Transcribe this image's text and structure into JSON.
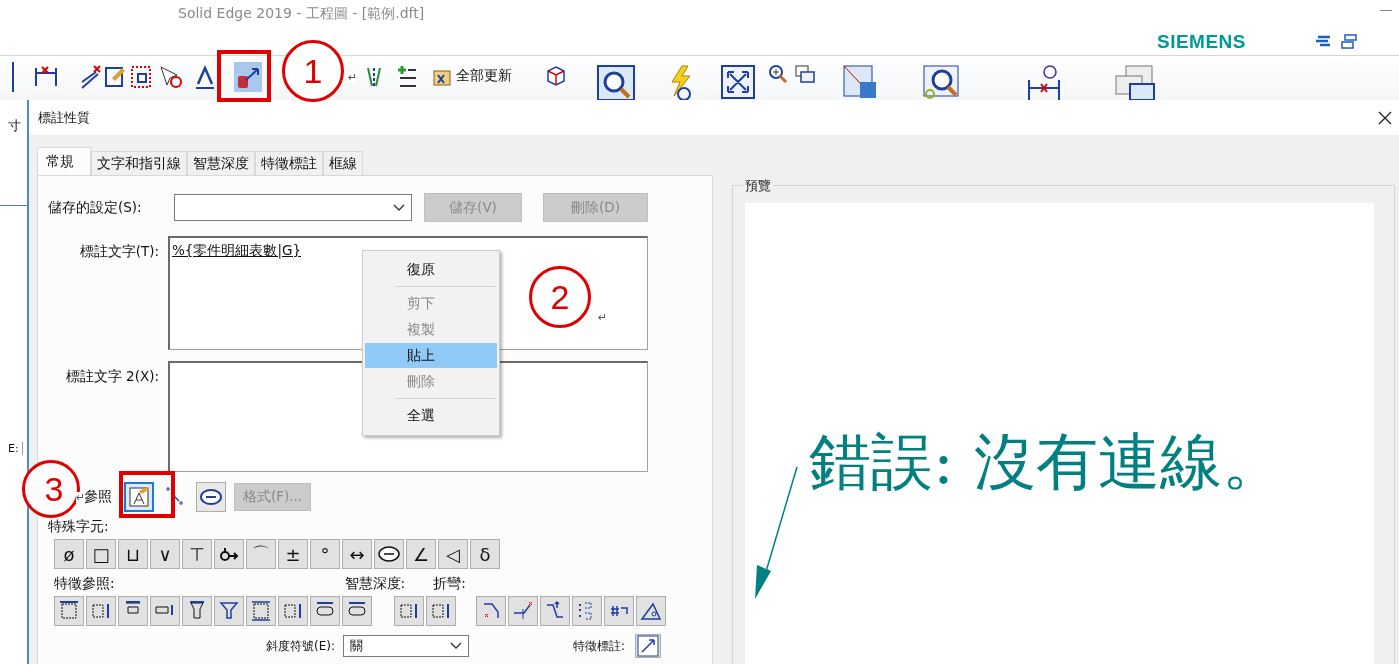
{
  "background_window": {
    "title": "Solid Edge 2019 - 工程圖 - [範例.dft]",
    "brand": "SIEMENS",
    "fragments": [
      "寸",
      "E:"
    ]
  },
  "toolbar": {
    "items": [
      {
        "kind": "icon",
        "selected": false
      },
      {
        "kind": "icon",
        "selected": false
      },
      {
        "kind": "icon",
        "selected": false
      },
      {
        "kind": "icon",
        "selected": false
      },
      {
        "kind": "icon",
        "selected": false
      },
      {
        "kind": "icon",
        "selected": false
      },
      {
        "kind": "icon",
        "selected": true
      },
      {
        "kind": "icon",
        "selected": false
      },
      {
        "kind": "icon",
        "selected": false
      },
      {
        "kind": "label",
        "label": "全部更新",
        "selected": false
      },
      {
        "kind": "icon",
        "selected": false
      },
      {
        "kind": "icon",
        "selected": false
      },
      {
        "kind": "icon",
        "selected": false
      },
      {
        "kind": "icon",
        "selected": false
      },
      {
        "kind": "icon",
        "selected": false
      },
      {
        "kind": "icon",
        "selected": false
      },
      {
        "kind": "icon",
        "selected": false
      },
      {
        "kind": "icon",
        "selected": false
      },
      {
        "kind": "icon",
        "selected": false
      },
      {
        "kind": "icon",
        "selected": false
      }
    ]
  },
  "dialog": {
    "title": "標註性質",
    "tabs": [
      {
        "label": "常規",
        "selected": true
      },
      {
        "label": "文字和指引線",
        "selected": false
      },
      {
        "label": "智慧深度",
        "selected": false
      },
      {
        "label": "特徵標註",
        "selected": false
      },
      {
        "label": "框線",
        "selected": false
      }
    ],
    "saved_settings": {
      "label": "儲存的設定(S):",
      "buttons": [
        {
          "label": "儲存(V)",
          "disabled": true
        },
        {
          "label": "刪除(D)",
          "disabled": true
        }
      ]
    },
    "callout_text": {
      "label": "標註文字(T):",
      "value": "%{零件明細表數|G}"
    },
    "callout_text_2": {
      "label": "標註文字 2(X):"
    },
    "reference": {
      "label": "參照",
      "icons": [
        {
          "selected": true
        },
        {
          "selected": false
        },
        {
          "selected": false
        }
      ],
      "format_button": {
        "label": "格式(F)...",
        "disabled": true
      }
    },
    "special_characters": {
      "label": "特殊字元:",
      "items": [
        {
          "kind": "glyph",
          "text": "ø"
        },
        {
          "kind": "glyph",
          "text": "□"
        },
        {
          "kind": "glyph",
          "text": "⊔"
        },
        {
          "kind": "glyph",
          "text": "∨"
        },
        {
          "kind": "glyph",
          "text": "⊤"
        },
        {
          "kind": "icon"
        },
        {
          "kind": "glyph",
          "text": "⌒"
        },
        {
          "kind": "glyph",
          "text": "±"
        },
        {
          "kind": "glyph",
          "text": "°"
        },
        {
          "kind": "glyph",
          "text": "↔"
        },
        {
          "kind": "icon"
        },
        {
          "kind": "glyph",
          "text": "∠"
        },
        {
          "kind": "glyph",
          "text": "◁"
        },
        {
          "kind": "glyph",
          "text": "δ"
        }
      ]
    },
    "feature_reference": {
      "label": "特徵參照:"
    },
    "smart_depth": {
      "label": "智慧深度:"
    },
    "bend": {
      "label": "折彎:"
    },
    "slope_symbol": {
      "label": "斜度符號(E):",
      "value": "關"
    },
    "feature_callout": {
      "label": "特徵標註:"
    },
    "preview": {
      "label": "預覽",
      "message": "錯誤: 沒有連線。"
    }
  },
  "context_menu": {
    "items": [
      {
        "kind": "item",
        "label": "復原",
        "disabled": false,
        "selected": false
      },
      {
        "kind": "separator"
      },
      {
        "kind": "item",
        "label": "剪下",
        "disabled": true,
        "selected": false
      },
      {
        "kind": "item",
        "label": "複製",
        "disabled": true,
        "selected": false
      },
      {
        "kind": "item",
        "label": "貼上",
        "disabled": false,
        "selected": true
      },
      {
        "kind": "item",
        "label": "刪除",
        "disabled": true,
        "selected": false
      },
      {
        "kind": "separator"
      },
      {
        "kind": "item",
        "label": "全選",
        "disabled": false,
        "selected": false
      }
    ]
  },
  "annotations": [
    {
      "number": "1",
      "mark": "↵"
    },
    {
      "number": "2",
      "mark": "↵"
    },
    {
      "number": "3",
      "mark": "↵"
    }
  ]
}
